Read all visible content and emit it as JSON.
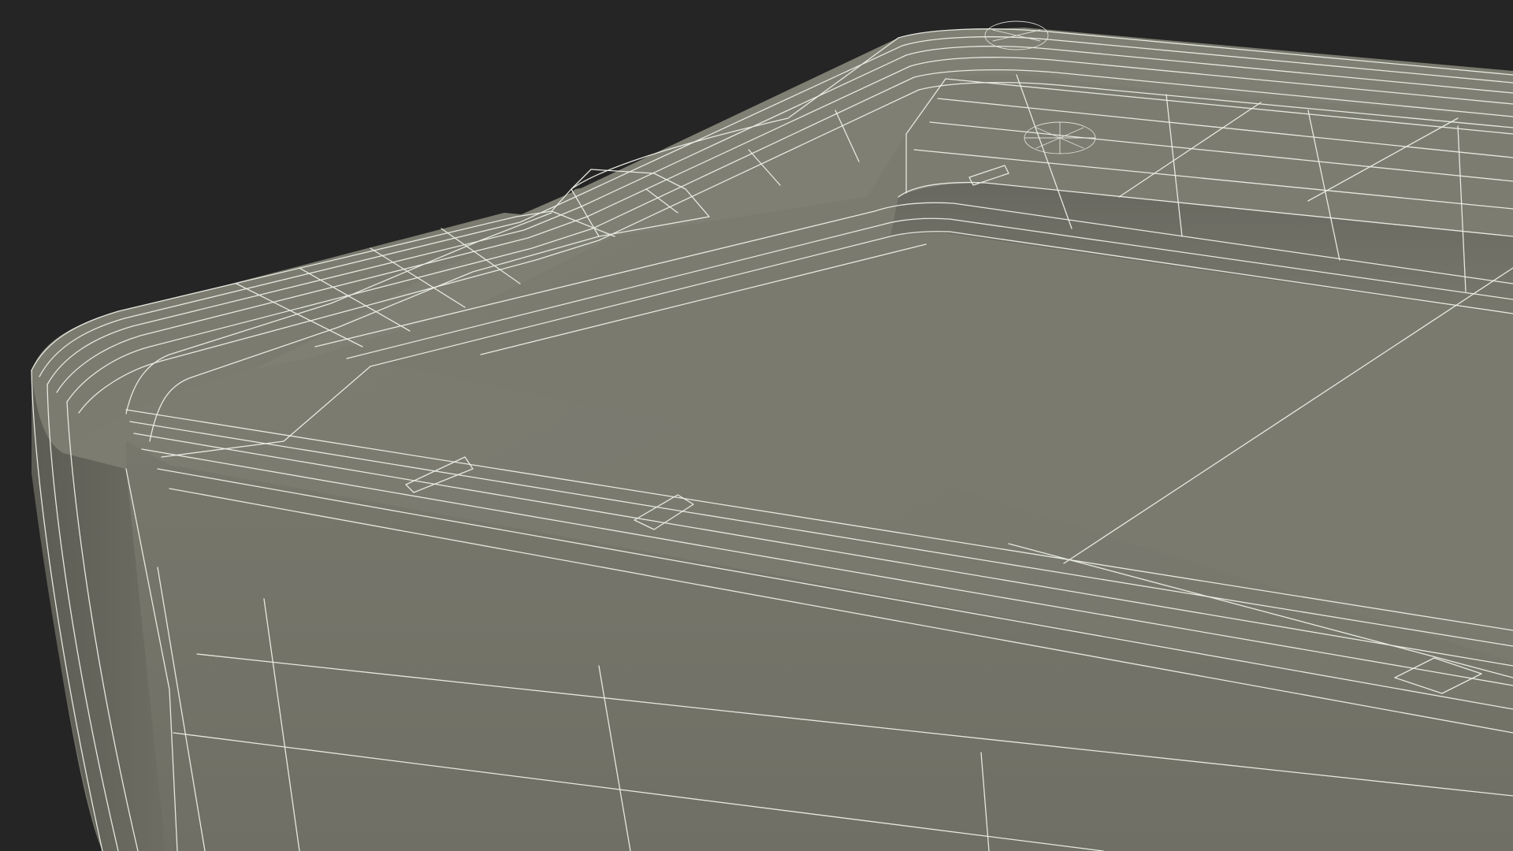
{
  "scene": {
    "background_color": "#252525",
    "mesh_color": "#7a7a6f",
    "mesh_shadow_color": "#5f5f56",
    "mesh_highlight_color": "#8a8a7f",
    "wire_color": "#ecefe6",
    "subject": "wireframe-3d-model-box-lid-corner"
  }
}
